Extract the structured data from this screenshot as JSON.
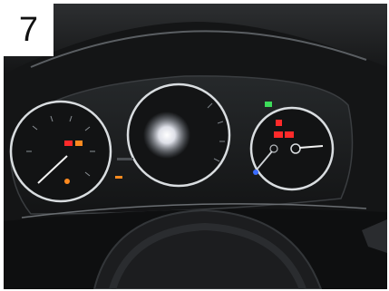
{
  "badge": {
    "step_number": "7"
  },
  "scene": {
    "background_color": "#171819",
    "bezel_color": "#2b2d2f",
    "ring_color": "#d9dde0",
    "warning_light_color": "#ff2a2a",
    "amber_light_color": "#ff8a1f",
    "glare_color": "#ffffff",
    "needle_color": "#f2f2f2",
    "green_light_color": "#3ddc5a"
  }
}
